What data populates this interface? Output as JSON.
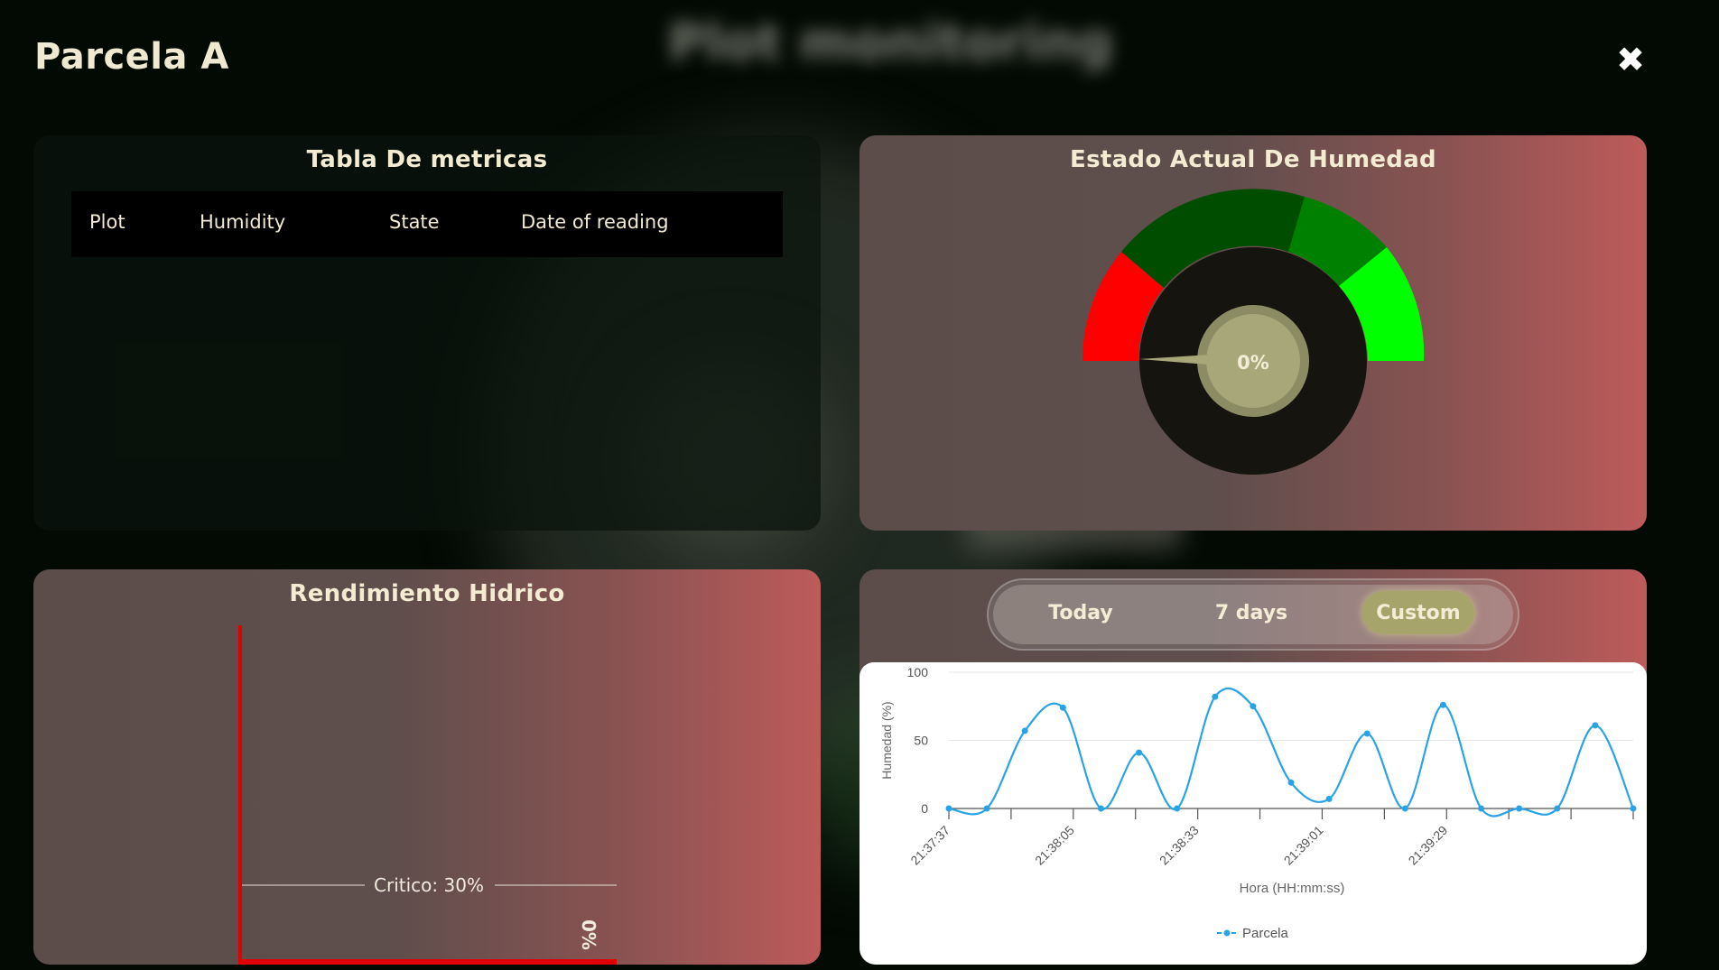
{
  "modal": {
    "title": "Parcela A",
    "close_icon": "✖"
  },
  "background": {
    "title": "Plot monitoring"
  },
  "metrics_panel": {
    "title": "Tabla De metricas",
    "columns": [
      "Plot",
      "Humidity",
      "State",
      "Date of reading"
    ]
  },
  "gauge_panel": {
    "title": "Estado Actual De Humedad",
    "value_label": "0%",
    "value": 0,
    "colors": {
      "red": "#ff0000",
      "dark_green": "#004d00",
      "green": "#008000",
      "bright_green": "#00ff00",
      "center": "#a7a77a"
    }
  },
  "yield_panel": {
    "title": "Rendimiento Hidrico",
    "critical_label": "Critico: 30%",
    "bar_label": "0%",
    "value": 0,
    "axis_color": "#e00000"
  },
  "history_panel": {
    "tabs": [
      {
        "label": "Today",
        "active": false
      },
      {
        "label": "7 days",
        "active": false
      },
      {
        "label": "Custom",
        "active": true
      }
    ]
  },
  "chart_data": {
    "type": "line",
    "xlabel": "Hora (HH:mm:ss)",
    "ylabel": "Humedad (%)",
    "ylim": [
      0,
      100
    ],
    "yticks": [
      0,
      50,
      100
    ],
    "xtick_labels": [
      "21:37:37",
      "21:38:05",
      "21:38:33",
      "21:39:01",
      "21:39:29"
    ],
    "series": [
      {
        "name": "Parcela",
        "color": "#29a3e6",
        "values": [
          0,
          0,
          57,
          74,
          0,
          41,
          0,
          82,
          75,
          19,
          7,
          55,
          0,
          76,
          0,
          0,
          0,
          61,
          0
        ]
      }
    ],
    "legend": "bottom",
    "grid": true
  }
}
